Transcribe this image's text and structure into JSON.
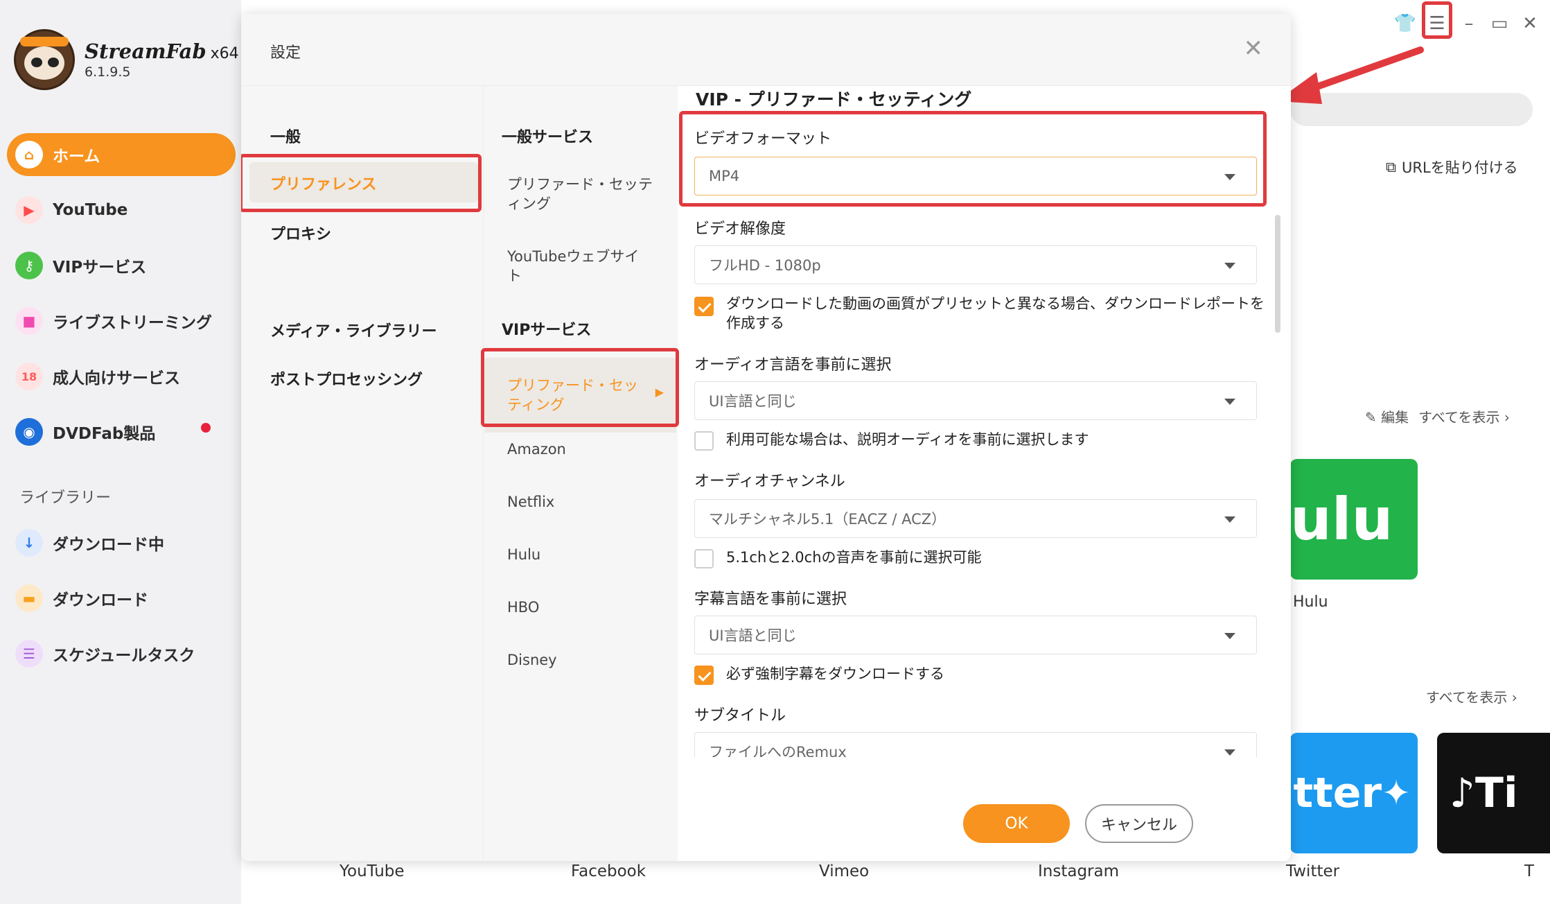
{
  "app": {
    "brand": "StreamFab",
    "arch": "x64",
    "version": "6.1.9.5"
  },
  "sidebar": {
    "items": [
      {
        "label": "ホーム",
        "icon": "home-icon",
        "color": "#f7931e"
      },
      {
        "label": "YouTube",
        "icon": "youtube-icon",
        "color": "#ff4d4d"
      },
      {
        "label": "VIPサービス",
        "icon": "key-icon",
        "color": "#4cc24a"
      },
      {
        "label": "ライブストリーミング",
        "icon": "camera-icon",
        "color": "#f04ab0"
      },
      {
        "label": "成人向けサービス",
        "icon": "adult-icon",
        "color": "#ff5a5a"
      },
      {
        "label": "DVDFab製品",
        "icon": "dvdfab-icon",
        "color": "#1e6fd9"
      }
    ],
    "library_title": "ライブラリー",
    "library_items": [
      {
        "label": "ダウンロード中",
        "icon": "download-arrow-icon",
        "color": "#2f7ff0"
      },
      {
        "label": "ダウンロード",
        "icon": "folder-icon",
        "color": "#f7a21e"
      },
      {
        "label": "スケジュールタスク",
        "icon": "schedule-icon",
        "color": "#a35bd6"
      }
    ]
  },
  "background": {
    "paste_url": "URLを貼り付ける",
    "edit": "編集",
    "show_all": "すべてを表示",
    "tiles": {
      "hulu_text": "ulu",
      "twitter_text": "tter",
      "tiktok_text": "Ti"
    },
    "tile_labels": {
      "hulu": "Hulu"
    },
    "bottom_labels": [
      "YouTube",
      "Facebook",
      "Vimeo",
      "Instagram",
      "Twitter",
      "T"
    ]
  },
  "dialog": {
    "title": "設定",
    "close": "✕",
    "col1": {
      "general": "一般",
      "preference": "プリファレンス",
      "proxy": "プロキシ",
      "media_library": "メディア・ライブラリー",
      "post_processing": "ポストプロセッシング"
    },
    "col2": {
      "general_service": "一般サービス",
      "preferred_setting": "プリファード・セッティング",
      "youtube_website": "YouTubeウェブサイト",
      "vip_service": "VIPサービス",
      "vip_preferred": "プリファード・セッティング",
      "services": [
        "Amazon",
        "Netflix",
        "Hulu",
        "HBO",
        "Disney"
      ]
    },
    "content": {
      "title": "VIP - プリファード・セッティング",
      "video_format_label": "ビデオフォーマット",
      "video_format_value": "MP4",
      "resolution_label": "ビデオ解像度",
      "resolution_value": "フルHD - 1080p",
      "report_check": "ダウンロードした動画の画質がプリセットと異なる場合、ダウンロードレポートを作成する",
      "audio_lang_label": "オーディオ言語を事前に選択",
      "audio_lang_value": "UI言語と同じ",
      "desc_audio_check": "利用可能な場合は、説明オーディオを事前に選択します",
      "audio_channel_label": "オーディオチャンネル",
      "audio_channel_value": "マルチシャネル5.1（EACZ / ACZ）",
      "channel_check": "5.1chと2.0chの音声を事前に選択可能",
      "subtitle_lang_label": "字幕言語を事前に選択",
      "subtitle_lang_value": "UI言語と同じ",
      "forced_sub_check": "必ず強制字幕をダウンロードする",
      "subtitle_label": "サブタイトル",
      "subtitle_value": "ファイルへのRemux"
    },
    "ok": "OK",
    "cancel": "キャンセル"
  },
  "colors": {
    "accent": "#f7931e",
    "highlight": "#e03a3e"
  }
}
